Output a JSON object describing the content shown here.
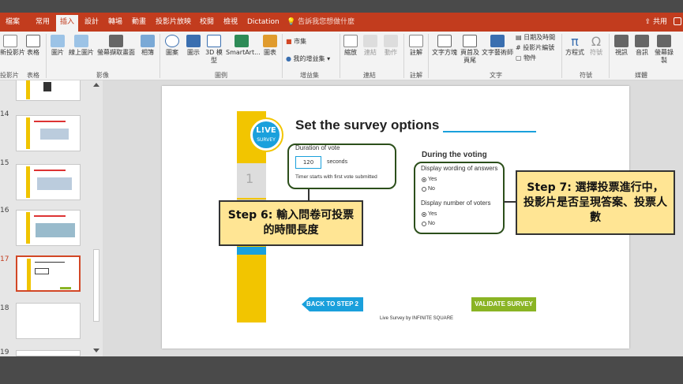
{
  "tabs": [
    "檔案",
    "常用",
    "插入",
    "設計",
    "轉場",
    "動畫",
    "投影片放映",
    "校閱",
    "檢視",
    "Dictation"
  ],
  "active_tab": "插入",
  "tell_me": "告訴我您想做什麼",
  "share": "共用",
  "ribbon": {
    "new_slide": "新投影片",
    "table": "表格",
    "pictures": "圖片",
    "online_pictures": "線上圖片",
    "screenshot": "螢幕擷取畫面",
    "album": "相簿",
    "shapes": "圖案",
    "icons": "圖示",
    "models_3d": "3D 模型",
    "smartart": "SmartArt...",
    "chart": "圖表",
    "store": "市集",
    "my_addins": "我的增益集",
    "zoom": "縮放",
    "link": "連結",
    "action": "動作",
    "comment": "註解",
    "textbox": "文字方塊",
    "header_footer": "頁首及頁尾",
    "wordart": "文字藝術師",
    "date_time": "日期及時間",
    "slide_number": "投影片編號",
    "object": "物件",
    "equation": "方程式",
    "symbol": "符號",
    "video": "視訊",
    "audio": "音訊",
    "screen_recording": "螢幕錄製",
    "groups": {
      "slides": "投影片",
      "tables": "表格",
      "images": "影像",
      "illustrations": "圖例",
      "addins": "增益集",
      "links": "連結",
      "comments": "註解",
      "text": "文字",
      "symbols": "符號",
      "media": "媒體"
    }
  },
  "thumbnails": [
    "14",
    "15",
    "16",
    "17",
    "18",
    "19"
  ],
  "selected_thumbnail": "17",
  "slide": {
    "title": "Set the survey options",
    "duration_label": "Duration of vote",
    "duration_value": "120",
    "seconds": "seconds",
    "timer_note": "Timer starts with first vote submitted",
    "during_voting": "During the voting",
    "display_wording": "Display wording of answers",
    "display_voters": "Display number of voters",
    "yes": "Yes",
    "no": "No",
    "step_number": "1",
    "logo_line1": "L!VE",
    "logo_line2": "SURVEY",
    "back_button": "BACK TO STEP 2",
    "validate_button": "VALIDATE SURVEY",
    "footer": "Live Survey by INFINITE SQUARE"
  },
  "callouts": {
    "step6": "Step 6: 輸入問卷可投票的時間長度",
    "step7": "Step 7: 選擇投票進行中，投影片是否呈現答案、投票人數"
  }
}
